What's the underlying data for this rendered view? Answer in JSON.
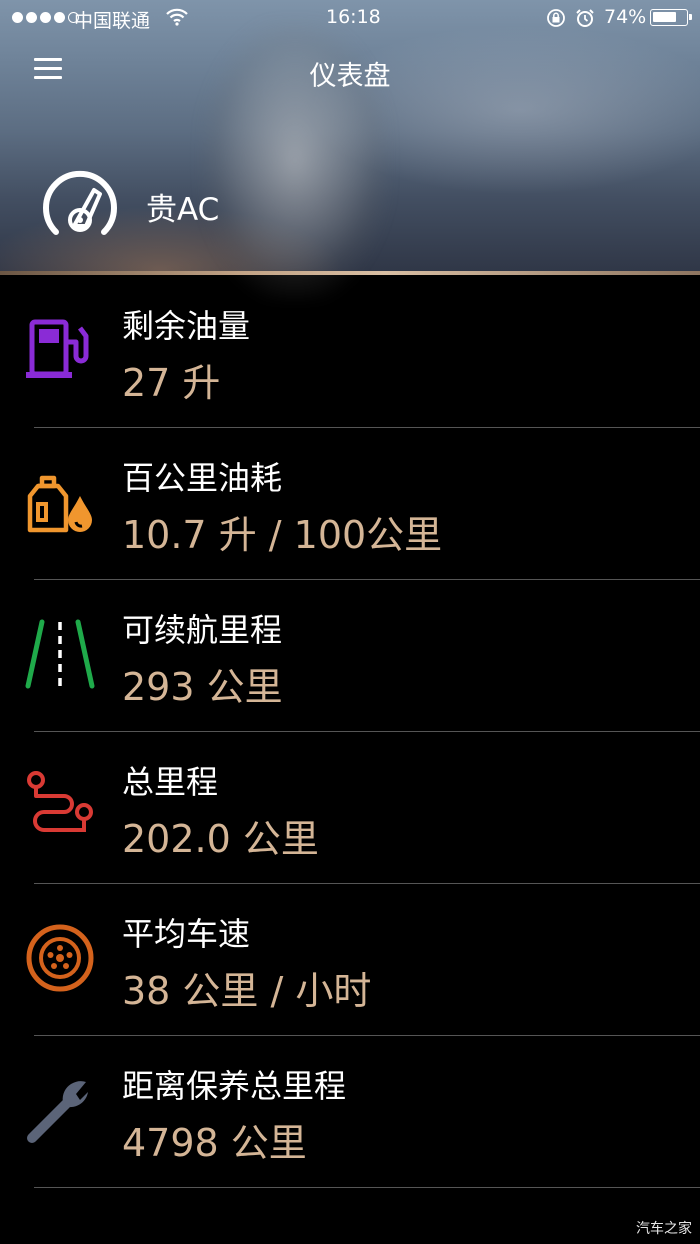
{
  "status_bar": {
    "carrier": "中国联通",
    "time": "16:18",
    "battery_percent": "74%",
    "battery_level": 0.74
  },
  "header": {
    "title": "仪表盘",
    "plate": "贵AC"
  },
  "metrics": [
    {
      "icon": "fuel-pump-icon",
      "color": "#8a2bd6",
      "label": "剩余油量",
      "value": "27 升"
    },
    {
      "icon": "oil-can-icon",
      "color": "#f0962e",
      "label": "百公里油耗",
      "value": "10.7 升 / 100公里"
    },
    {
      "icon": "road-icon",
      "color": "#1faa4a",
      "label": "可续航里程",
      "value": "293 公里"
    },
    {
      "icon": "route-icon",
      "color": "#d93a34",
      "label": "总里程",
      "value": "202.0 公里"
    },
    {
      "icon": "wheel-icon",
      "color": "#d4621c",
      "label": "平均车速",
      "value": "38 公里 / 小时"
    },
    {
      "icon": "wrench-icon",
      "color": "#5b6478",
      "label": "距离保养总里程",
      "value": "4798 公里"
    }
  ],
  "watermark": "汽车之家"
}
